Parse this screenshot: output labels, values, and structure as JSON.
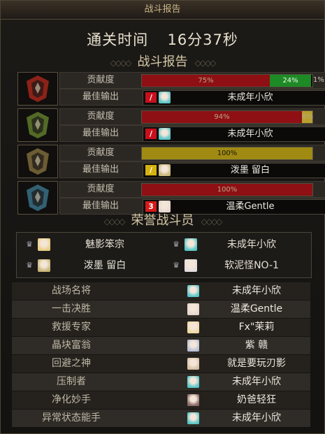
{
  "window": {
    "title": "战斗报告"
  },
  "clear_time": {
    "label": "通关时间",
    "value": "16分37秒"
  },
  "report_section": {
    "title": "战斗报告"
  },
  "teams": [
    {
      "contribution_label": "贡献度",
      "best_output_label": "最佳输出",
      "bars": [
        {
          "pct_text": "75%",
          "fraction": 0.75,
          "color": "#8e1014"
        },
        {
          "pct_text": "24%",
          "fraction": 0.24,
          "color": "#1d8a25"
        }
      ],
      "tail_text": "1%",
      "player": "未成年小欣",
      "class_color": "#c8101c",
      "avatar_color": "#5bc7c9",
      "emblem_color": "#a3261b"
    },
    {
      "contribution_label": "贡献度",
      "best_output_label": "最佳输出",
      "bars": [
        {
          "pct_text": "94%",
          "fraction": 0.94,
          "color": "#8e1014"
        },
        {
          "pct_text": "6%",
          "fraction": 0.06,
          "color": "#b79f2f"
        }
      ],
      "tail_text": "",
      "player": "未成年小欣",
      "class_color": "#c8101c",
      "avatar_color": "#5bc7c9",
      "emblem_color": "#5f7a2d"
    },
    {
      "contribution_label": "贡献度",
      "best_output_label": "最佳输出",
      "bars": [
        {
          "pct_text": "100%",
          "fraction": 1.0,
          "color": "#a08a12"
        }
      ],
      "tail_text": "",
      "player": "泼墨 留白",
      "class_color": "#d5b20f",
      "avatar_color": "#c9b678",
      "emblem_color": "#7d6a3c"
    },
    {
      "contribution_label": "贡献度",
      "best_output_label": "最佳输出",
      "bars": [
        {
          "pct_text": "100%",
          "fraction": 1.0,
          "color": "#8e1014"
        }
      ],
      "tail_text": "",
      "player": "温柔Gentle",
      "class_color": "#d41a1a",
      "class_glyph": "3",
      "avatar_color": "#e7d6cf",
      "emblem_color": "#3a6e86"
    }
  ],
  "honor_section": {
    "title": "荣誉战斗员"
  },
  "honor_members": [
    {
      "name": "魅影笨宗",
      "avatar_color": "#e9cf84"
    },
    {
      "name": "未成年小欣",
      "avatar_color": "#5bc7c9"
    },
    {
      "name": "泼墨 留白",
      "avatar_color": "#c9b678"
    },
    {
      "name": "软泥怪NO-1",
      "avatar_color": "#e4dde0"
    }
  ],
  "awards": [
    {
      "title": "战场名将",
      "player": "未成年小欣",
      "avatar_color": "#5bc7c9"
    },
    {
      "title": "一击决胜",
      "player": "温柔Gentle",
      "avatar_color": "#e7d6cf"
    },
    {
      "title": "救援专家",
      "player": "Fx\"茉莉",
      "avatar_color": "#efd9a2"
    },
    {
      "title": "晶块富翁",
      "player": "紫 赣",
      "avatar_color": "#b8bfd8"
    },
    {
      "title": "回避之神",
      "player": "就是要玩刃影",
      "avatar_color": "#d9c1a6"
    },
    {
      "title": "压制者",
      "player": "未成年小欣",
      "avatar_color": "#5bc7c9"
    },
    {
      "title": "净化妙手",
      "player": "奶爸轻狂",
      "avatar_color": "#8c6a68"
    },
    {
      "title": "异常状态能手",
      "player": "未成年小欣",
      "avatar_color": "#5bc7c9"
    }
  ]
}
